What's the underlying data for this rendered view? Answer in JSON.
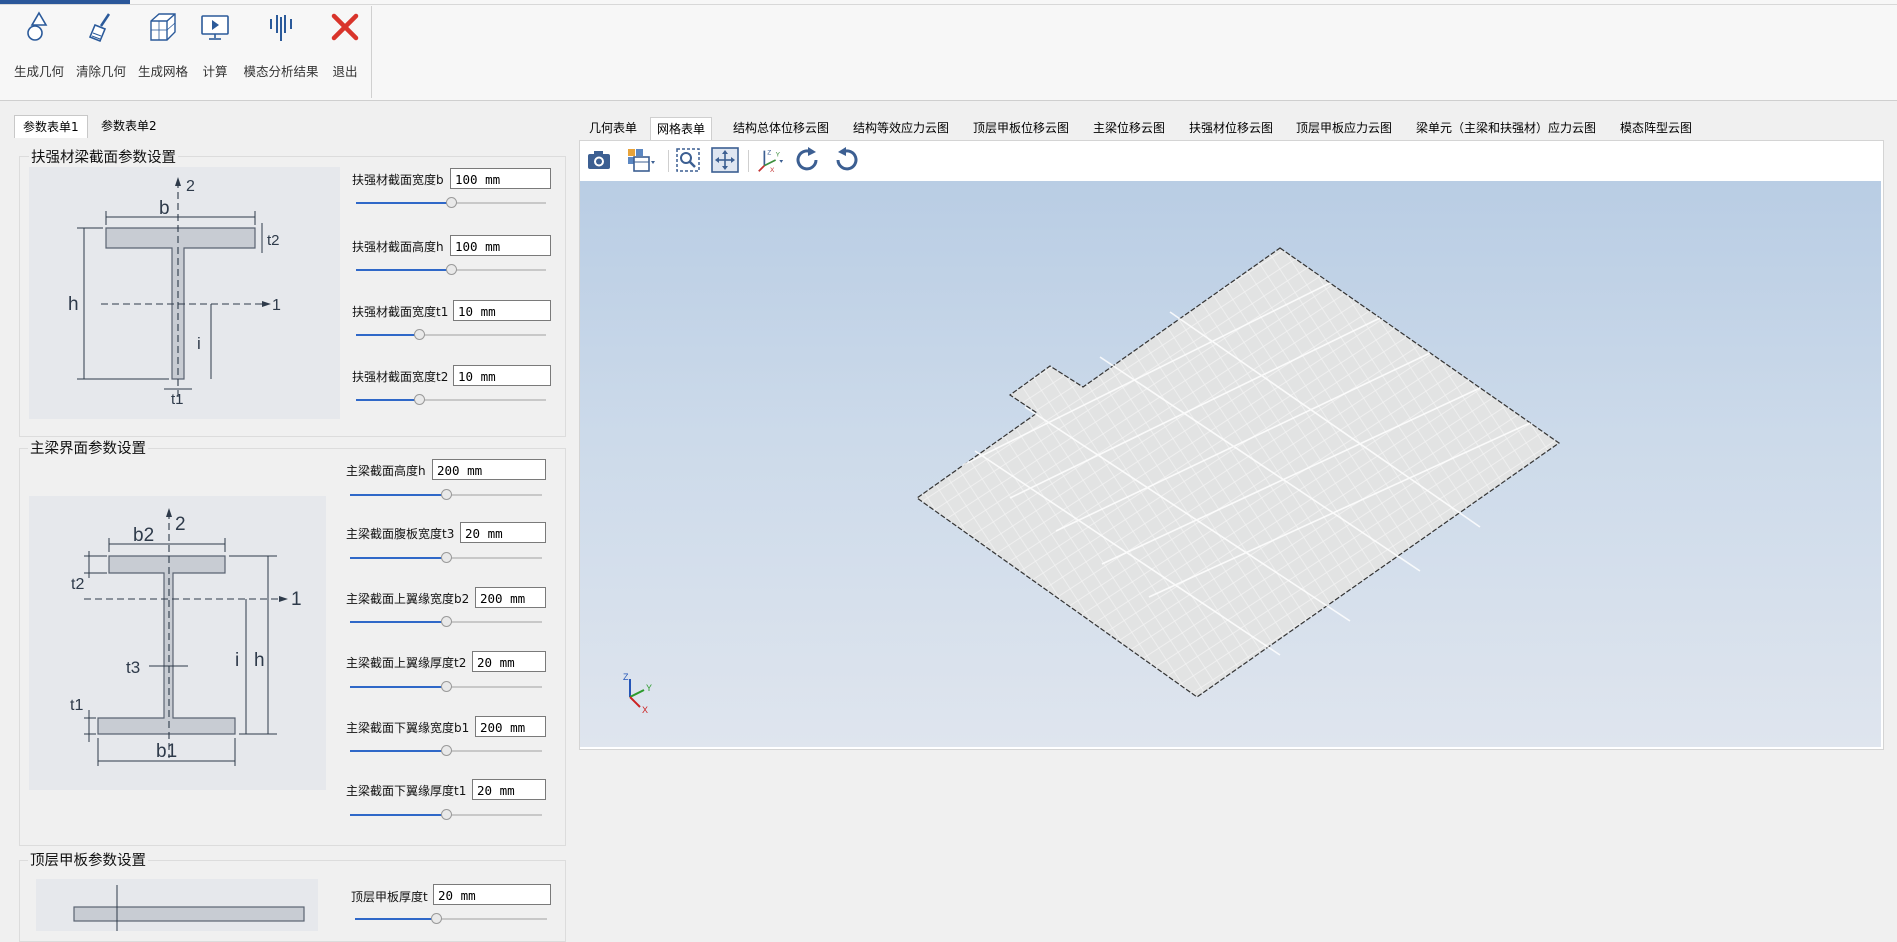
{
  "ribbon": {
    "buttons": [
      {
        "label": "生成几何",
        "icon": "geometry-shapes-icon"
      },
      {
        "label": "清除几何",
        "icon": "brush-icon"
      },
      {
        "label": "生成网格",
        "icon": "mesh-cube-icon"
      },
      {
        "label": "计算",
        "icon": "monitor-play-icon"
      },
      {
        "label": "模态分析结果",
        "icon": "modal-bars-icon"
      },
      {
        "label": "退出",
        "icon": "exit-x-icon"
      }
    ]
  },
  "left_tabs": [
    "参数表单1",
    "参数表单2"
  ],
  "groups": {
    "stiffener": {
      "title": "扶强材梁截面参数设置",
      "diagram": {
        "b": "b",
        "t2": "t2",
        "h": "h",
        "i": "i",
        "t1": "t1",
        "axis2": "2",
        "axis1": "1"
      },
      "params": [
        {
          "label": "扶强材截面宽度b",
          "value": "100 mm",
          "fraction": 0.5
        },
        {
          "label": "扶强材截面高度h",
          "value": "100 mm",
          "fraction": 0.5
        },
        {
          "label": "扶强材截面宽度t1",
          "value": "10 mm",
          "fraction": 0.33
        },
        {
          "label": "扶强材截面宽度t2",
          "value": "10 mm",
          "fraction": 0.33
        }
      ]
    },
    "main_beam": {
      "title": "主梁界面参数设置",
      "diagram": {
        "b2": "b2",
        "t2": "t2",
        "t3": "t3",
        "t1": "t1",
        "b1": "b1",
        "i": "i",
        "h": "h",
        "axis2": "2",
        "axis1": "1"
      },
      "params": [
        {
          "label": "主梁截面高度h",
          "value": "200 mm",
          "fraction": 0.5
        },
        {
          "label": "主梁截面腹板宽度t3",
          "value": "20 mm",
          "fraction": 0.5
        },
        {
          "label": "主梁截面上翼缘宽度b2",
          "value": "200 mm",
          "fraction": 0.5
        },
        {
          "label": "主梁截面上翼缘厚度t2",
          "value": "20 mm",
          "fraction": 0.5
        },
        {
          "label": "主梁截面下翼缘宽度b1",
          "value": "200 mm",
          "fraction": 0.5
        },
        {
          "label": "主梁截面下翼缘厚度t1",
          "value": "20 mm",
          "fraction": 0.5
        }
      ]
    },
    "deck": {
      "title": "顶层甲板参数设置",
      "params": [
        {
          "label": "顶层甲板厚度t",
          "value": "20 mm",
          "fraction": 0.42
        }
      ]
    }
  },
  "right_tabs": [
    "几何表单",
    "网格表单",
    "结构总体位移云图",
    "结构等效应力云图",
    "顶层甲板位移云图",
    "主梁位移云图",
    "扶强材位移云图",
    "顶层甲板应力云图",
    "梁单元（主梁和扶强材）应力云图",
    "模态阵型云图"
  ],
  "active_right_tab": 1,
  "viewer_toolbar": [
    "camera-icon",
    "view-cube-icon",
    "zoom-box-icon",
    "fit-all-icon",
    "axes-orientation-icon",
    "rotate-cw-icon",
    "rotate-ccw-icon"
  ],
  "triad": {
    "x": "X",
    "y": "Y",
    "z": "Z"
  },
  "colors": {
    "accent": "#2b579a",
    "slider": "#2f68c8",
    "exit": "#d9342b"
  }
}
